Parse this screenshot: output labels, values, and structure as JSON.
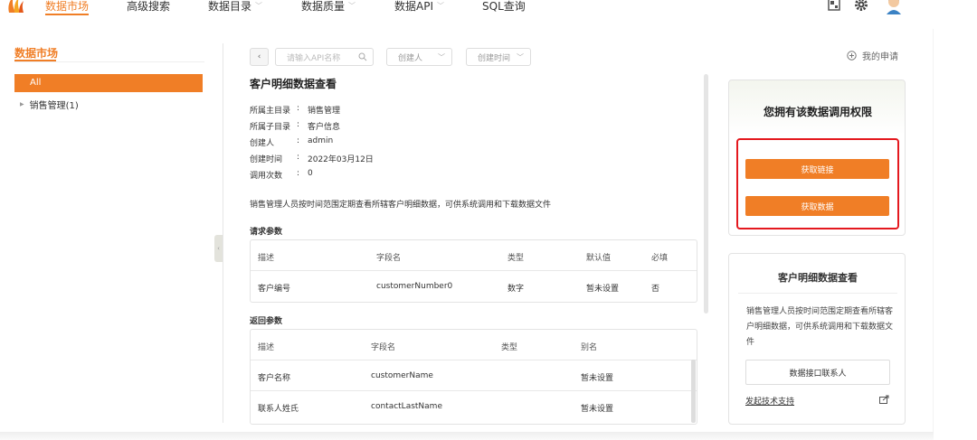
{
  "nav": {
    "items": [
      {
        "label": "数据市场",
        "active": true,
        "dropdown": false
      },
      {
        "label": "高级搜索",
        "active": false,
        "dropdown": false
      },
      {
        "label": "数据目录",
        "active": false,
        "dropdown": true
      },
      {
        "label": "数据质量",
        "active": false,
        "dropdown": true
      },
      {
        "label": "数据API",
        "active": false,
        "dropdown": true
      },
      {
        "label": "SQL查询",
        "active": false,
        "dropdown": false
      }
    ],
    "icons": [
      "app-switch-icon",
      "gear-icon",
      "user-avatar-icon"
    ]
  },
  "sidebar": {
    "title": "数据市场",
    "all_label": "All",
    "tree": [
      {
        "label": "销售管理(1)"
      }
    ]
  },
  "filters": {
    "back_icon": "chevron-left-icon",
    "search_placeholder": "请输入API名称",
    "creator_label": "创建人",
    "created_time_label": "创建时间"
  },
  "detail": {
    "title": "客户明细数据查看",
    "meta": [
      {
        "label": "所属主目录",
        "value": "销售管理"
      },
      {
        "label": "所属子目录",
        "value": "客户信息"
      },
      {
        "label": "创建人",
        "value": "admin"
      },
      {
        "label": "创建时间",
        "value": "2022年03月12日"
      },
      {
        "label": "调用次数",
        "value": "0"
      }
    ],
    "description": "销售管理人员按时间范围定期查看所辖客户明细数据，可供系统调用和下载数据文件",
    "request_params": {
      "title": "请求参数",
      "columns": [
        "描述",
        "字段名",
        "类型",
        "默认值",
        "必填"
      ],
      "rows": [
        [
          "客户编号",
          "customerNumber0",
          "数字",
          "暂未设置",
          "否"
        ]
      ]
    },
    "return_params": {
      "title": "返回参数",
      "columns": [
        "描述",
        "字段名",
        "类型",
        "别名"
      ],
      "rows": [
        [
          "客户名称",
          "customerName",
          "",
          "暂未设置"
        ],
        [
          "联系人姓氏",
          "contactLastName",
          "",
          "暂未设置"
        ]
      ]
    }
  },
  "right": {
    "my_apply": "我的申请",
    "permission_title": "您拥有该数据调用权限",
    "get_link_button": "获取链接",
    "get_data_button": "获取数据",
    "info_title": "客户明细数据查看",
    "info_desc": "销售管理人员按时间范围定期查看所辖客户明细数据，可供系统调用和下载数据文件",
    "contact_button": "数据接口联系人",
    "support_link": "发起技术支持"
  },
  "colors": {
    "accent": "#f07e26",
    "highlight_border": "#e4181e"
  }
}
